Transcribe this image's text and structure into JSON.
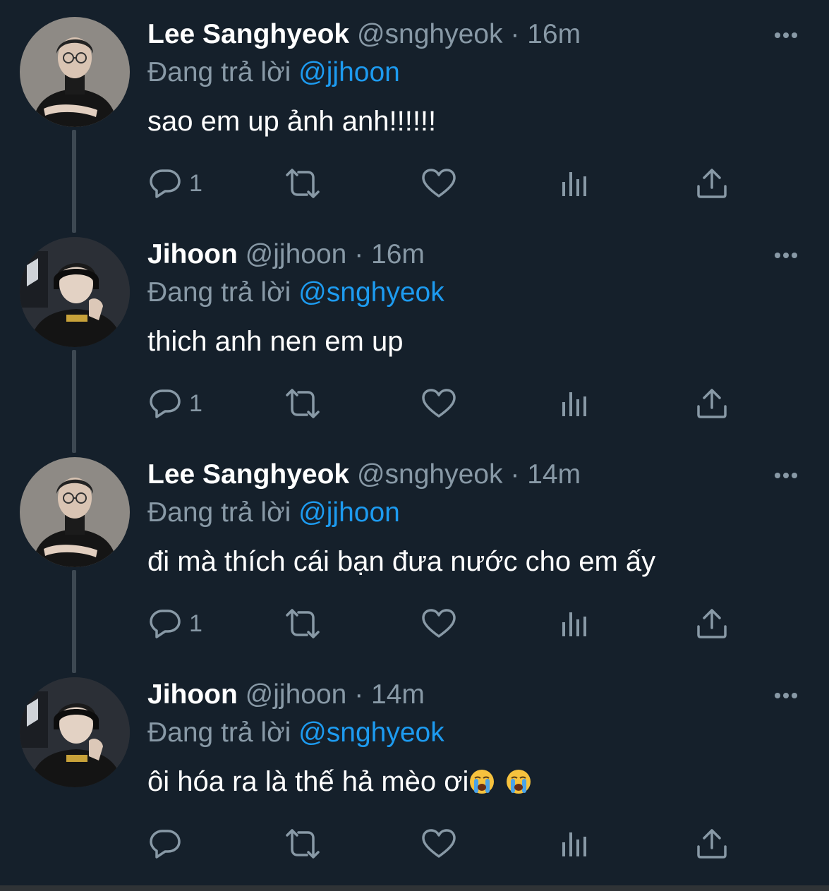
{
  "tweets": [
    {
      "author_name": "Lee Sanghyeok",
      "author_handle": "@snghyeok",
      "separator": "·",
      "time": "16m",
      "reply_prefix": "Đang trả lời",
      "reply_to": "@jjhoon",
      "text": "sao em up ảnh anh!!!!!!",
      "reply_count": "1",
      "avatar": "avatar-sanghyeok",
      "has_thread_line": true
    },
    {
      "author_name": "Jihoon",
      "author_handle": "@jjhoon",
      "separator": "·",
      "time": "16m",
      "reply_prefix": "Đang trả lời",
      "reply_to": "@snghyeok",
      "text": "thich anh nen em up",
      "reply_count": "1",
      "avatar": "avatar-jihoon",
      "has_thread_line": true
    },
    {
      "author_name": "Lee Sanghyeok",
      "author_handle": "@snghyeok",
      "separator": "·",
      "time": "14m",
      "reply_prefix": "Đang trả lời",
      "reply_to": "@jjhoon",
      "text": "đi mà thích cái bạn đưa nước cho em ấy",
      "reply_count": "1",
      "avatar": "avatar-sanghyeok",
      "has_thread_line": true
    },
    {
      "author_name": "Jihoon",
      "author_handle": "@jjhoon",
      "separator": "·",
      "time": "14m",
      "reply_prefix": "Đang trả lời",
      "reply_to": "@snghyeok",
      "text": "ôi hóa ra là thế hả mèo ơi",
      "text_emoji": [
        "loudly-crying-face-emoji",
        "loudly-crying-face-emoji"
      ],
      "reply_count": "",
      "avatar": "avatar-jihoon",
      "has_thread_line": false
    }
  ],
  "icons": {
    "reply": "reply-icon",
    "retweet": "retweet-icon",
    "like": "heart-icon",
    "views": "views-icon",
    "share": "share-icon",
    "more": "more-options-icon"
  },
  "colors": {
    "background": "#15202b",
    "primary_text": "#ffffff",
    "secondary_text": "#8899a6",
    "mention": "#1d9bf0",
    "thread_line": "#3d4852"
  }
}
